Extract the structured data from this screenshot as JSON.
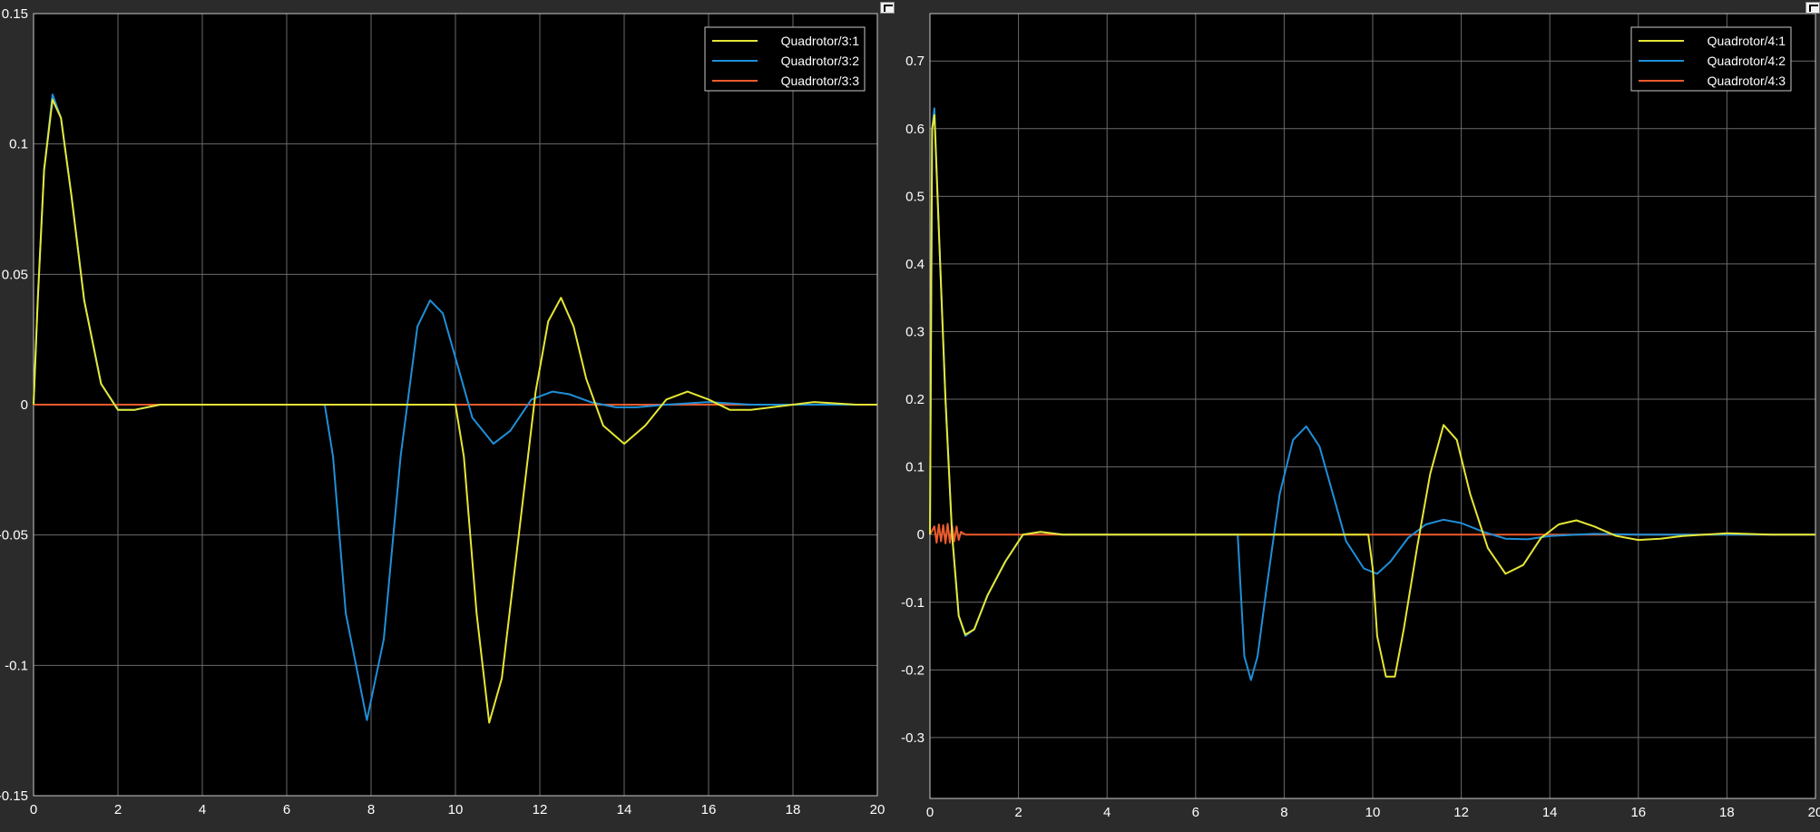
{
  "colors": {
    "background": "#000000",
    "frame": "#2b2b2b",
    "grid": "#6a6a6a",
    "axis": "#c8c8c8",
    "text": "#ffffff",
    "series1": "#e6e635",
    "series2": "#1f8fd8",
    "series3": "#ef5b2c"
  },
  "icons": [
    "undock-icon"
  ],
  "chart_data": [
    {
      "type": "line",
      "xlim": [
        0,
        20
      ],
      "ylim": [
        -0.15,
        0.15
      ],
      "xticks": [
        0,
        2,
        4,
        6,
        8,
        10,
        12,
        14,
        16,
        18,
        20
      ],
      "yticks": [
        -0.15,
        -0.1,
        -0.05,
        0,
        0.05,
        0.1,
        0.15
      ],
      "xtick_labels": [
        "0",
        "2",
        "4",
        "6",
        "8",
        "10",
        "12",
        "14",
        "16",
        "18",
        "20"
      ],
      "ytick_labels": [
        "-0.15",
        "-0.1",
        "-0.05",
        "0",
        "0.05",
        "0.1",
        "0.15"
      ],
      "grid": true,
      "legend_position": "top-right",
      "series": [
        {
          "name": "Quadrotor/3:1",
          "x": [
            0,
            0.1,
            0.25,
            0.45,
            0.65,
            0.9,
            1.2,
            1.6,
            2.0,
            2.4,
            3.0,
            4,
            6,
            7,
            8,
            9,
            9.8,
            10.0,
            10.2,
            10.5,
            10.8,
            11.1,
            11.5,
            11.9,
            12.2,
            12.5,
            12.8,
            13.1,
            13.5,
            14.0,
            14.5,
            15.0,
            15.5,
            16.0,
            16.5,
            17.0,
            17.5,
            18.5,
            19.5,
            20
          ],
          "y": [
            0,
            0.04,
            0.09,
            0.117,
            0.11,
            0.08,
            0.04,
            0.008,
            -0.002,
            -0.002,
            0,
            0,
            0,
            0,
            0,
            0,
            0,
            0,
            -0.02,
            -0.08,
            -0.122,
            -0.105,
            -0.05,
            0.005,
            0.032,
            0.041,
            0.03,
            0.01,
            -0.008,
            -0.015,
            -0.008,
            0.002,
            0.005,
            0.002,
            -0.002,
            -0.002,
            -0.001,
            0.001,
            0,
            0
          ]
        },
        {
          "name": "Quadrotor/3:2",
          "x": [
            0,
            0.1,
            0.25,
            0.45,
            0.65,
            0.9,
            1.2,
            1.6,
            2.0,
            2.4,
            3.0,
            4,
            6,
            6.9,
            7.1,
            7.4,
            7.9,
            8.3,
            8.7,
            9.1,
            9.4,
            9.7,
            10.0,
            10.4,
            10.9,
            11.3,
            11.8,
            12.3,
            12.7,
            13.2,
            13.8,
            14.3,
            15.0,
            16,
            17,
            18,
            20
          ],
          "y": [
            0,
            0.04,
            0.09,
            0.119,
            0.11,
            0.08,
            0.04,
            0.008,
            -0.002,
            -0.002,
            0,
            0,
            0,
            0,
            -0.02,
            -0.08,
            -0.121,
            -0.09,
            -0.02,
            0.03,
            0.04,
            0.035,
            0.018,
            -0.005,
            -0.015,
            -0.01,
            0.002,
            0.005,
            0.004,
            0.001,
            -0.001,
            -0.001,
            0,
            0.001,
            0,
            0,
            0
          ]
        },
        {
          "name": "Quadrotor/3:3",
          "x": [
            0,
            20
          ],
          "y": [
            0,
            0
          ]
        }
      ]
    },
    {
      "type": "line",
      "xlim": [
        0,
        20
      ],
      "ylim": [
        -0.39,
        0.77
      ],
      "xticks": [
        0,
        2,
        4,
        6,
        8,
        10,
        12,
        14,
        16,
        18,
        20
      ],
      "yticks": [
        -0.3,
        -0.2,
        -0.1,
        0,
        0.1,
        0.2,
        0.3,
        0.4,
        0.5,
        0.6,
        0.7
      ],
      "xtick_labels": [
        "0",
        "2",
        "4",
        "6",
        "8",
        "10",
        "12",
        "14",
        "16",
        "18",
        "20"
      ],
      "ytick_labels": [
        "-0.3",
        "-0.2",
        "-0.1",
        "0",
        "0.1",
        "0.2",
        "0.3",
        "0.4",
        "0.5",
        "0.6",
        "0.7"
      ],
      "grid": true,
      "legend_position": "top-right",
      "series": [
        {
          "name": "Quadrotor/4:1",
          "x": [
            0,
            0.05,
            0.1,
            0.2,
            0.35,
            0.5,
            0.65,
            0.8,
            1.0,
            1.3,
            1.7,
            2.1,
            2.5,
            3,
            5,
            7,
            8,
            9,
            9.9,
            10.0,
            10.1,
            10.3,
            10.5,
            10.7,
            11.0,
            11.3,
            11.6,
            11.9,
            12.2,
            12.6,
            13.0,
            13.4,
            13.8,
            14.2,
            14.6,
            15.0,
            15.5,
            16.0,
            16.5,
            17.0,
            18,
            19,
            20
          ],
          "y": [
            0,
            0.6,
            0.62,
            0.45,
            0.2,
            0.0,
            -0.12,
            -0.148,
            -0.14,
            -0.09,
            -0.04,
            0.0,
            0.004,
            0,
            0,
            0,
            0,
            0,
            0,
            -0.05,
            -0.15,
            -0.21,
            -0.21,
            -0.14,
            -0.02,
            0.09,
            0.162,
            0.14,
            0.06,
            -0.02,
            -0.058,
            -0.045,
            -0.005,
            0.015,
            0.021,
            0.012,
            -0.002,
            -0.008,
            -0.006,
            -0.002,
            0.002,
            0,
            0
          ]
        },
        {
          "name": "Quadrotor/4:2",
          "x": [
            0,
            0.05,
            0.1,
            0.2,
            0.35,
            0.5,
            0.65,
            0.8,
            1.0,
            1.3,
            1.7,
            2.1,
            2.5,
            3,
            5,
            6.95,
            7.0,
            7.1,
            7.25,
            7.4,
            7.6,
            7.9,
            8.2,
            8.5,
            8.8,
            9.1,
            9.4,
            9.8,
            10.1,
            10.4,
            10.8,
            11.2,
            11.6,
            12.0,
            12.5,
            13.0,
            13.5,
            14.0,
            15,
            16,
            20
          ],
          "y": [
            0,
            0.6,
            0.63,
            0.45,
            0.2,
            0.0,
            -0.12,
            -0.15,
            -0.14,
            -0.09,
            -0.04,
            0.0,
            0.004,
            0,
            0,
            0,
            -0.06,
            -0.18,
            -0.215,
            -0.18,
            -0.08,
            0.06,
            0.14,
            0.16,
            0.13,
            0.06,
            -0.01,
            -0.05,
            -0.058,
            -0.04,
            -0.005,
            0.015,
            0.022,
            0.017,
            0.004,
            -0.006,
            -0.007,
            -0.002,
            0.001,
            0,
            0
          ]
        },
        {
          "name": "Quadrotor/4:3",
          "x": [
            0,
            0.1,
            0.15,
            0.2,
            0.25,
            0.3,
            0.35,
            0.4,
            0.45,
            0.5,
            0.55,
            0.6,
            0.65,
            0.7,
            0.8,
            1,
            20
          ],
          "y": [
            0,
            0.012,
            -0.012,
            0.015,
            -0.01,
            0.014,
            -0.013,
            0.016,
            -0.012,
            0.013,
            -0.01,
            0.012,
            -0.008,
            0.004,
            0,
            0,
            0
          ]
        }
      ]
    }
  ]
}
